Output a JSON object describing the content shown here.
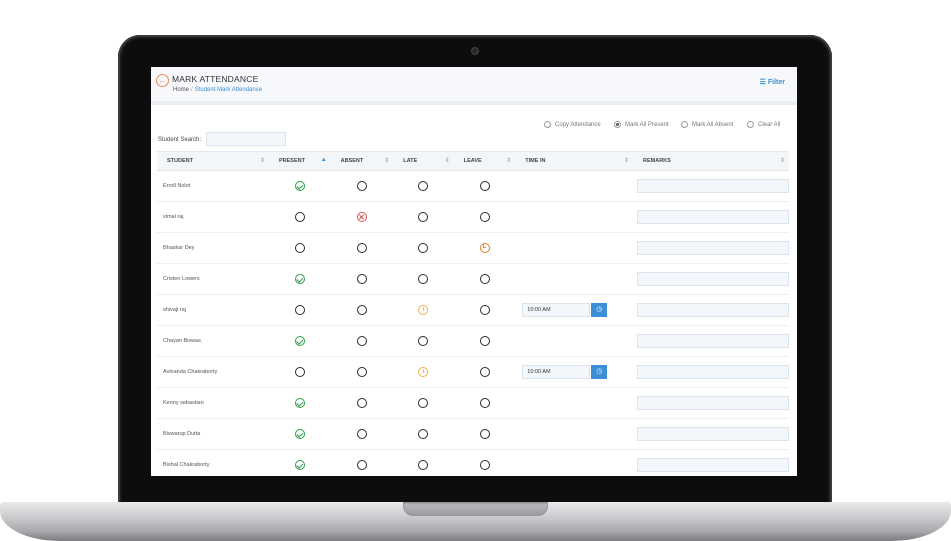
{
  "header": {
    "back_icon": "arrow-left-icon",
    "title": "MARK ATTENDANCE",
    "breadcrumb": {
      "home": "Home",
      "separator": "/",
      "current": "Student Mark Attendance"
    },
    "filter_label": "Filter",
    "filter_icon": "list-icon"
  },
  "bulk_actions": {
    "copy": "Copy Attendance",
    "present": "Mark All Present",
    "absent": "Mark All Absent",
    "clear": "Clear All",
    "selected": "present"
  },
  "search": {
    "label": "Student Search:",
    "value": "",
    "placeholder": ""
  },
  "table": {
    "columns": [
      "STUDENT",
      "PRESENT",
      "ABSENT",
      "LATE",
      "LEAVE",
      "TIME IN",
      "REMARKS"
    ],
    "sorted_column": "PRESENT",
    "rows": [
      {
        "name": "Erroll Nolot",
        "status": "present",
        "time_in": null,
        "remarks": ""
      },
      {
        "name": "vimal raj",
        "status": "absent",
        "time_in": null,
        "remarks": ""
      },
      {
        "name": "Bhaskar Dey",
        "status": "leave",
        "time_in": null,
        "remarks": ""
      },
      {
        "name": "Cristen Lowers",
        "status": "present",
        "time_in": null,
        "remarks": ""
      },
      {
        "name": "shivaji raj",
        "status": "late",
        "time_in": "10:00 AM",
        "remarks": ""
      },
      {
        "name": "Chayan Biswas",
        "status": "present",
        "time_in": null,
        "remarks": ""
      },
      {
        "name": "Avinanda Chakraborty",
        "status": "late",
        "time_in": "10:00 AM",
        "remarks": ""
      },
      {
        "name": "Kenny sebastian",
        "status": "present",
        "time_in": null,
        "remarks": ""
      },
      {
        "name": "Biswarup Dutta",
        "status": "present",
        "time_in": null,
        "remarks": ""
      },
      {
        "name": "Bishal Chakraborty",
        "status": "present",
        "time_in": null,
        "remarks": ""
      }
    ]
  },
  "colors": {
    "accent": "#3a8fd6",
    "present": "#2e9e4e",
    "absent": "#d9534f",
    "late": "#f0ad4e",
    "leave": "#e67e22"
  }
}
